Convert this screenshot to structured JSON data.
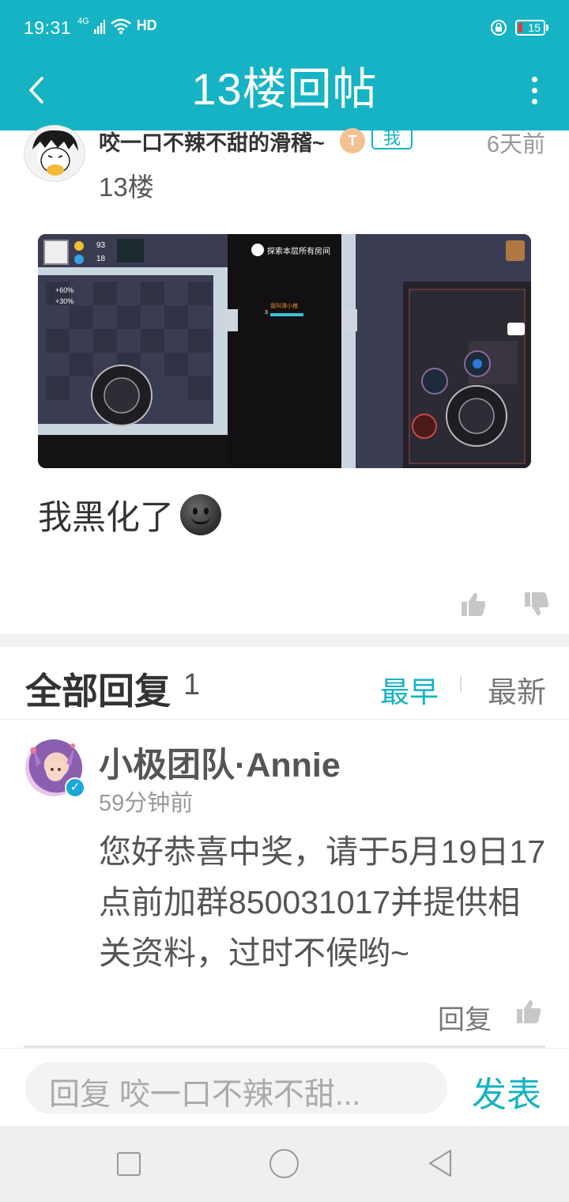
{
  "status_bar": {
    "time": "19:31",
    "network": "4G",
    "wifi_label": "HD",
    "battery": "15"
  },
  "header": {
    "title": "13楼回帖",
    "bg_color": "#16b3c4"
  },
  "post": {
    "author": "咬一口不辣不甜的滑稽~",
    "badge_level": "T",
    "badge_me": "我",
    "time": "6天前",
    "floor": "13楼",
    "image": {
      "coins": "93",
      "gems": "18",
      "banner": "探索本层所有房间",
      "buff_1": "+60%",
      "buff_2": "+30%",
      "player_name": "我叫滑小稽",
      "player_level": "3"
    },
    "text": "我黑化了"
  },
  "replies": {
    "title": "全部回复",
    "count": "1",
    "sort_earliest": "最早",
    "sort_newest": "最新",
    "active_sort": "最早",
    "items": [
      {
        "name": "小极团队·Annie",
        "time": "59分钟前",
        "content": "您好恭喜中奖，请于5月19日17点前加群850031017并提供相关资料，过时不候哟~",
        "reply_label": "回复"
      }
    ]
  },
  "composer": {
    "placeholder": "回复 咬一口不辣不甜...",
    "publish_label": "发表"
  }
}
